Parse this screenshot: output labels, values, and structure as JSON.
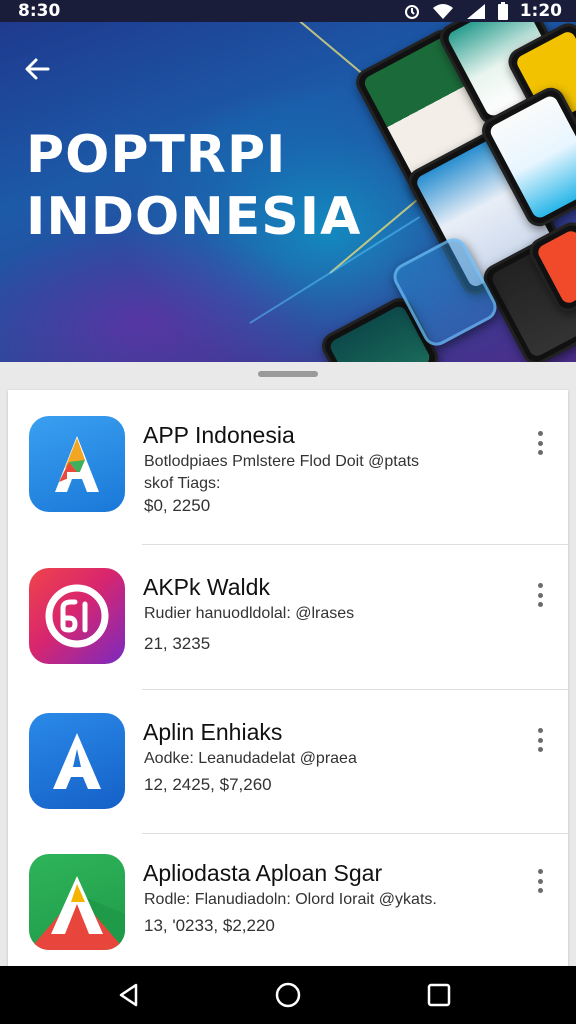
{
  "status_bar": {
    "time_left": "8:30",
    "time_right": "1:20",
    "icons": [
      "alarm-icon",
      "wifi-icon",
      "signal-icon",
      "battery-icon"
    ]
  },
  "hero": {
    "title_line1": "POPTRPI",
    "title_line2": "INDONESIA",
    "back_icon": "back-arrow-icon"
  },
  "apps": [
    {
      "name": "APP Indonesia",
      "line1": "Botlodpiaes Pmlstere Flod Doit @ptats",
      "line2": "skof Tiags:",
      "line3": "$0, 2250",
      "icon": "app-a-blue-icon"
    },
    {
      "name": "AKPk Waldk",
      "line1": "Rudier hanuodldolal: @lrases",
      "line2": "",
      "line3": "21, 3235",
      "icon": "app-ring-icon"
    },
    {
      "name": "Aplin Enhiaks",
      "line1": "Aodke: Leanudadelat @praea",
      "line2": "",
      "line3": "12, 2425,  $7,260",
      "icon": "app-a-white-icon"
    },
    {
      "name": "Apliodasta Aploan Sgar",
      "line1": "Rodle: Flanudiadoln: Olord Iorait @ykats.",
      "line2": "",
      "line3": "13, '0233,  $2,220",
      "icon": "app-a-tricolor-icon"
    }
  ],
  "nav": [
    "back-nav-icon",
    "home-nav-icon",
    "recents-nav-icon"
  ],
  "colors": {
    "hero_blue": "#1c5aa8",
    "hero_purple": "#4b2d8a",
    "nav": "#000000"
  }
}
